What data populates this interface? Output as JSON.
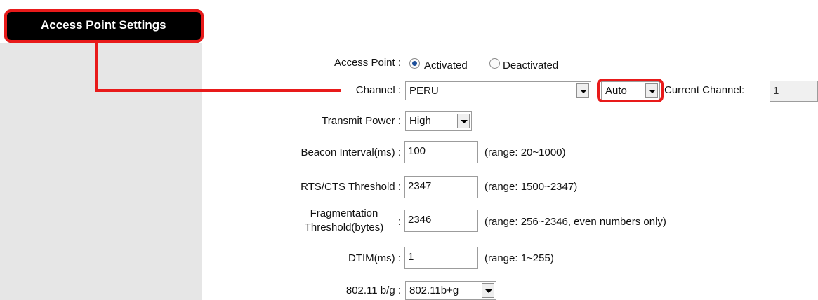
{
  "header": {
    "title": "Access Point Settings"
  },
  "access_point": {
    "label": "Access Point :",
    "options": [
      {
        "label": "Activated",
        "checked": true
      },
      {
        "label": "Deactivated",
        "checked": false
      }
    ]
  },
  "channel": {
    "label": "Channel :",
    "region_value": "PERU",
    "channel_value": "Auto",
    "current_label": "Current Channel:",
    "current_value": "1"
  },
  "transmit_power": {
    "label": "Transmit Power :",
    "value": "High"
  },
  "beacon_interval": {
    "label": "Beacon Interval(ms) :",
    "value": "100",
    "hint": "(range: 20~1000)"
  },
  "rts_cts": {
    "label": "RTS/CTS Threshold :",
    "value": "2347",
    "hint": "(range: 1500~2347)"
  },
  "fragmentation": {
    "label_line1": "Fragmentation",
    "label_line2": "Threshold(bytes)",
    "colon": ":",
    "value": "2346",
    "hint": "(range: 256~2346, even numbers only)"
  },
  "dtim": {
    "label": "DTIM(ms) :",
    "value": "1",
    "hint": "(range: 1~255)"
  },
  "mode": {
    "label": "802.11 b/g :",
    "value": "802.11b+g"
  },
  "colors": {
    "highlight": "#e81a1a",
    "header_bg": "#000000",
    "sidebar_bg": "#e6e6e6"
  }
}
